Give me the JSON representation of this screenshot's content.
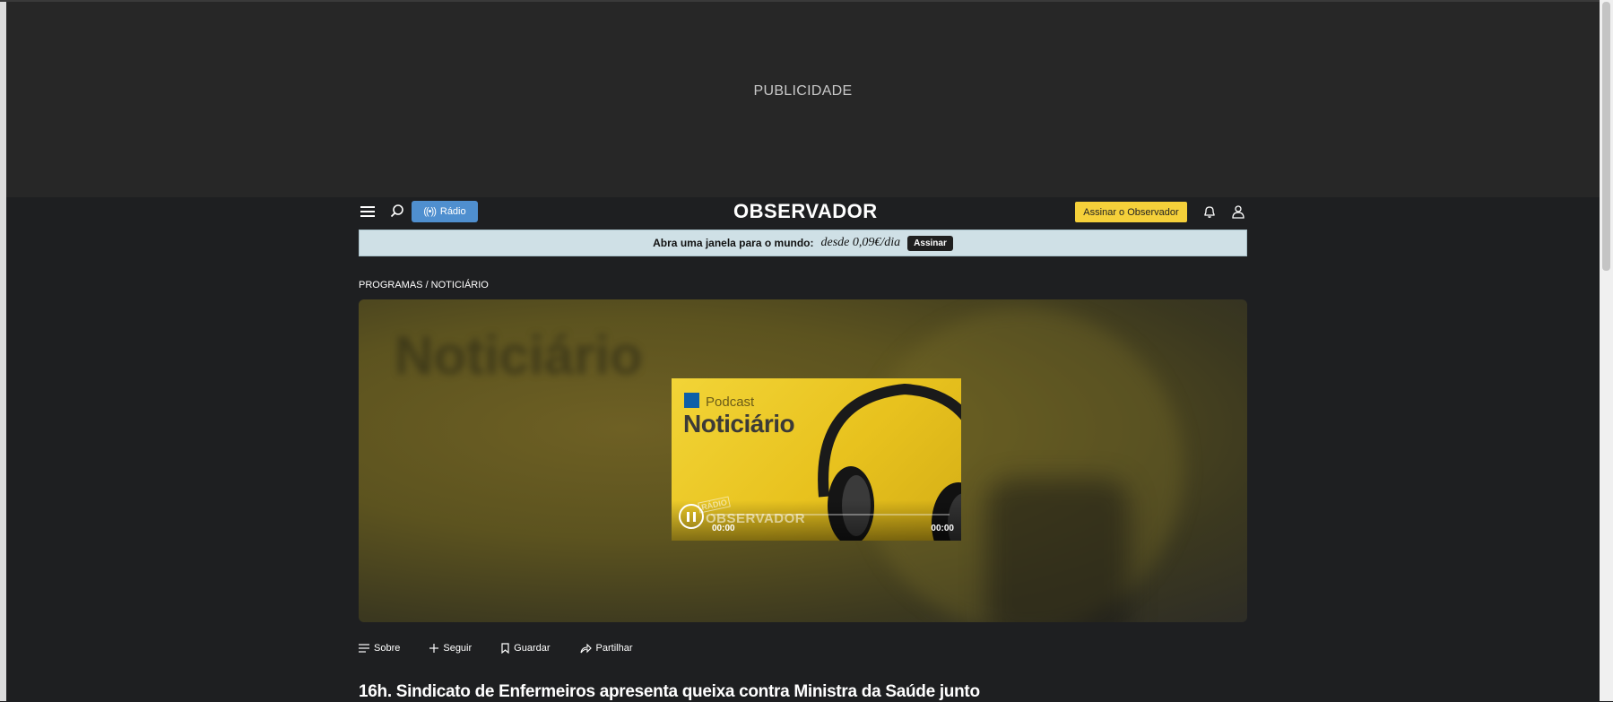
{
  "ad": {
    "label": "PUBLICIDADE"
  },
  "header": {
    "radio_label": "Rádio",
    "logo_text": "OBSERVADOR",
    "subscribe_label": "Assinar o Observador"
  },
  "promo": {
    "lead": "Abra uma janela para o mundo:",
    "price": "desde 0,09€/dia",
    "button": "Assinar"
  },
  "breadcrumb": {
    "text": "PROGRAMAS / NOTICIÁRIO"
  },
  "player": {
    "kicker": "Podcast",
    "title": "Noticiário",
    "watermark_small": "RÁDIO",
    "watermark": "OBSERVADOR",
    "time_current": "00:00",
    "time_total": "00:00",
    "hero_blur_text": "Noticiário"
  },
  "actions": [
    {
      "label": "Sobre"
    },
    {
      "label": "Seguir"
    },
    {
      "label": "Guardar"
    },
    {
      "label": "Partilhar"
    }
  ],
  "headline": "16h. Sindicato de Enfermeiros apresenta queixa contra Ministra da Saúde junto",
  "colors": {
    "accent_blue": "#4f8fcf",
    "subscribe_yellow": "#f5d03a",
    "promo_bg": "#cfe0e6",
    "page_bg": "#1e1f21"
  }
}
